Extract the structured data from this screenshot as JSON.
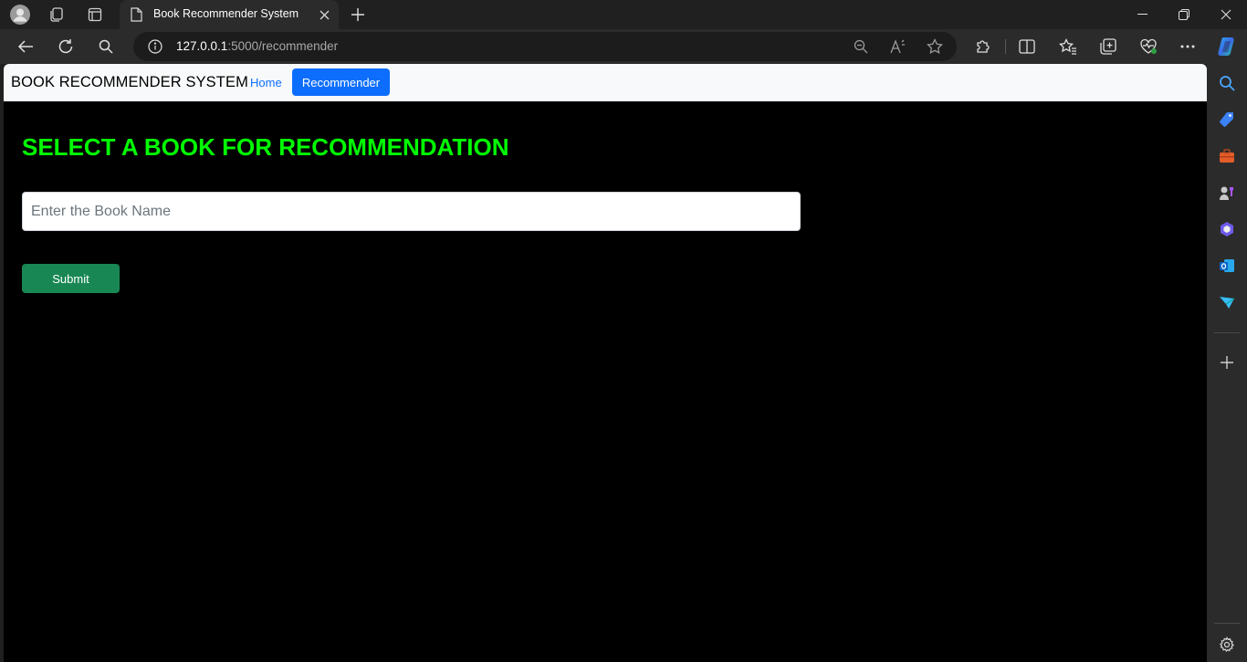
{
  "browser": {
    "tab": {
      "title": "Book Recommender System"
    },
    "address": {
      "host": "127.0.0.1",
      "path": ":5000/recommender"
    }
  },
  "page": {
    "navbar": {
      "brand": "BOOK RECOMMENDER SYSTEM",
      "links": [
        {
          "label": "Home",
          "active": false
        },
        {
          "label": "Recommender",
          "active": true
        }
      ]
    },
    "heading": "SELECT A BOOK FOR RECOMMENDATION",
    "form": {
      "input_value": "",
      "input_placeholder": "Enter the Book Name",
      "submit_label": "Submit"
    }
  },
  "colors": {
    "heading": "#00ff00",
    "primary": "#0d6efd",
    "success": "#198754",
    "background": "#000000"
  },
  "icons": {
    "tabstrip": [
      "profile-icon",
      "workspaces-icon",
      "tab-actions-icon",
      "page-icon",
      "close-icon",
      "new-tab-icon",
      "minimize-icon",
      "restore-icon",
      "close-window-icon"
    ],
    "toolbar": [
      "back-icon",
      "refresh-icon",
      "search-icon",
      "info-icon",
      "zoom-out-icon",
      "read-aloud-icon",
      "favorite-star-icon",
      "extensions-icon",
      "split-screen-icon",
      "favorites-icon",
      "collections-icon",
      "browser-essentials-icon",
      "more-icon",
      "copilot-icon"
    ],
    "sidebar": [
      "search-icon",
      "shopping-tag-icon",
      "tools-icon",
      "games-icon",
      "microsoft365-icon",
      "outlook-icon",
      "send-icon",
      "add-icon",
      "settings-icon"
    ]
  }
}
